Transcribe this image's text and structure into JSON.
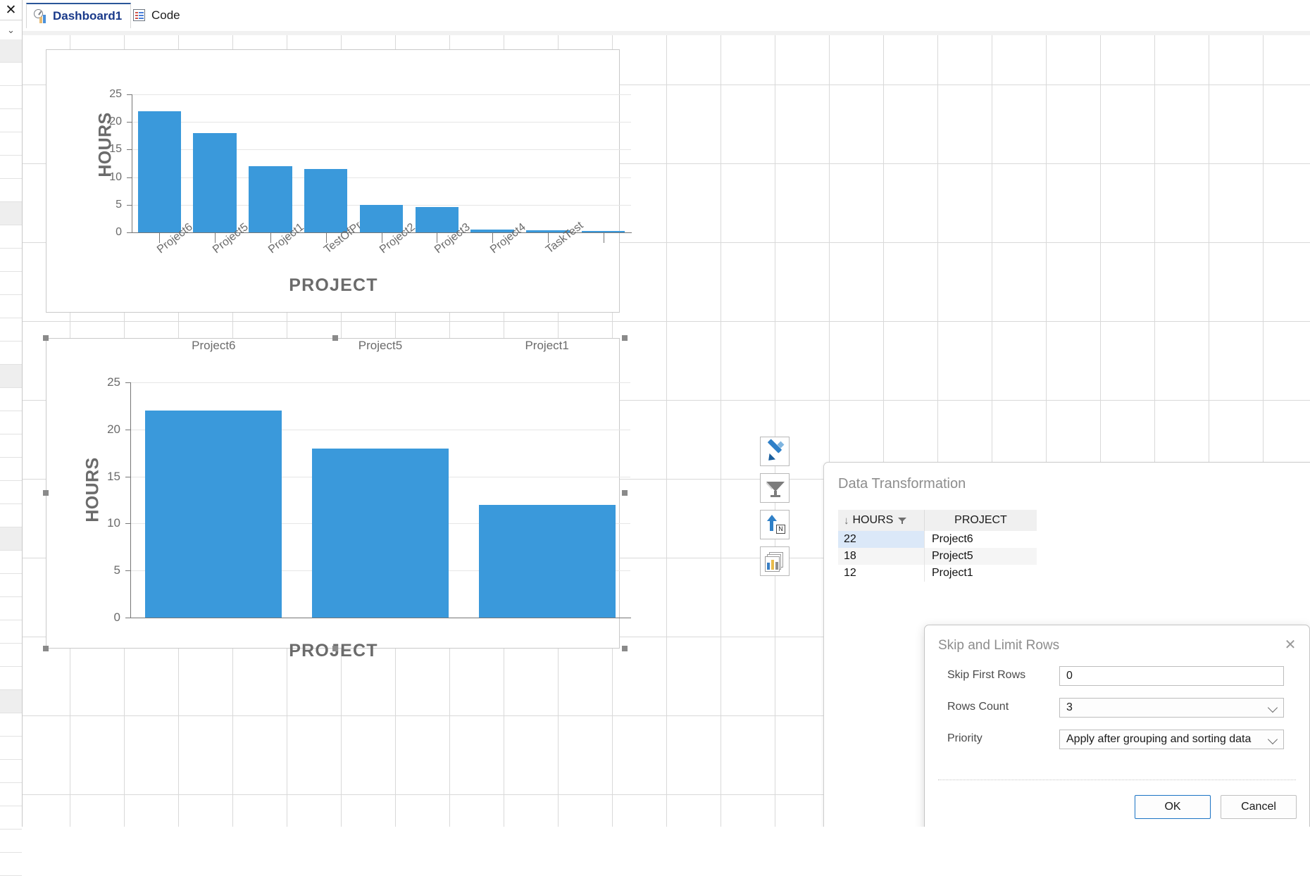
{
  "tabs": [
    {
      "label": "Dashboard1",
      "icon": "dashboard-gauge-icon",
      "active": true
    },
    {
      "label": "Code",
      "icon": "code-document-icon",
      "active": false
    }
  ],
  "rail": {
    "close_icon": "close-icon",
    "chevron_icon": "chevron-down-icon"
  },
  "toolbar": {
    "buttons": [
      {
        "name": "edit-pencil-icon",
        "label": "Edit"
      },
      {
        "name": "filter-funnel-icon",
        "label": "Filter"
      },
      {
        "name": "sort-ascending-icon",
        "label": "Sort"
      },
      {
        "name": "chart-series-icon",
        "label": "Series"
      }
    ]
  },
  "data_transformation": {
    "title": "Data Transformation",
    "columns": [
      "HOURS",
      "PROJECT"
    ],
    "sort_indicator": "↓",
    "filter_icon": "filter-icon",
    "rows": [
      {
        "hours": "22",
        "project": "Project6"
      },
      {
        "hours": "18",
        "project": "Project5"
      },
      {
        "hours": "12",
        "project": "Project1"
      }
    ]
  },
  "skip_limit_dialog": {
    "title": "Skip and Limit Rows",
    "close_icon": "close-icon",
    "fields": [
      {
        "label": "Skip First Rows",
        "value": "0",
        "type": "text"
      },
      {
        "label": "Rows Count",
        "value": "3",
        "type": "combo"
      },
      {
        "label": "Priority",
        "value": "Apply after grouping and sorting data",
        "type": "combo"
      }
    ],
    "ok_label": "OK",
    "cancel_label": "Cancel"
  },
  "colors": {
    "bar": "#3a99db",
    "accent": "#1b73c4",
    "tab_active_text": "#19398a"
  },
  "chart_data": [
    {
      "type": "bar",
      "title": "",
      "xlabel": "PROJECT",
      "ylabel": "HOURS",
      "ylim": [
        0,
        25
      ],
      "yticks": [
        0,
        5,
        10,
        15,
        20,
        25
      ],
      "grid": true,
      "legend": "none",
      "categories": [
        "Project6",
        "Project5",
        "Project1",
        "TestOfProject",
        "Project2",
        "Project3",
        "Project4",
        "TaskTest",
        ""
      ],
      "values": [
        22,
        18,
        12,
        11.5,
        5,
        4.6,
        0.45,
        0.4,
        0.25
      ]
    },
    {
      "type": "bar",
      "title": "",
      "xlabel": "PROJECT",
      "ylabel": "HOURS",
      "ylim": [
        0,
        25
      ],
      "yticks": [
        0,
        5,
        10,
        15,
        20,
        25
      ],
      "grid": true,
      "legend": "none",
      "categories": [
        "Project6",
        "Project5",
        "Project1"
      ],
      "values": [
        22,
        18,
        12
      ]
    }
  ]
}
